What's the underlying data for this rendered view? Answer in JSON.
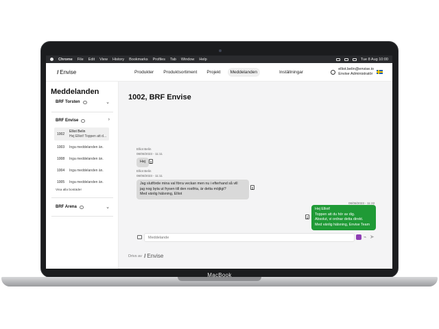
{
  "device": {
    "brand": "MacBook"
  },
  "menubar": {
    "app": "Chrome",
    "items": [
      "File",
      "Edit",
      "View",
      "History",
      "Bookmarks",
      "Profiles",
      "Tab",
      "Window",
      "Help"
    ],
    "clock": "Tue 8 Aug  10:00"
  },
  "header": {
    "logo_text": "Envise",
    "nav": [
      "Produkter",
      "Produktsortiment",
      "Projekt",
      "Meddelanden",
      "Inställningar"
    ],
    "active_nav": "Meddelanden",
    "user_email": "elliot.belin@envise.io",
    "user_role": "Envise Administratör"
  },
  "sidebar": {
    "title": "Meddelanden",
    "groups": [
      {
        "name": "BRF Torsten",
        "expanded": false
      },
      {
        "name": "BRF Envise",
        "expanded": true
      },
      {
        "name": "BRF Arena",
        "expanded": false
      }
    ],
    "threads": [
      {
        "id": "1002",
        "sender": "Elliot Belin",
        "preview": "Hej Elliot! Toppen att d...",
        "selected": true
      },
      {
        "id": "1003",
        "preview": "Inga meddelanden än."
      },
      {
        "id": "1008",
        "preview": "Inga meddelanden än."
      },
      {
        "id": "1004",
        "preview": "Inga meddelanden än."
      },
      {
        "id": "1005",
        "preview": "Inga meddelanden än."
      }
    ],
    "show_all": "Visa alla bostäder"
  },
  "conversation": {
    "title": "1002, BRF Envise",
    "messages": [
      {
        "direction": "in",
        "sender": "Elliot Belin",
        "timestamp": "08/08/2023 - 11:11",
        "text": "Hej"
      },
      {
        "direction": "in",
        "sender": "Elliot Belin",
        "timestamp": "08/08/2023 - 11:11",
        "lines": [
          "Jag slutförde mina val förra veckan men nu i efterhand så vill",
          "jag nog byta ut frysen till den rostfria, är detta möjligt?",
          "Med vänlig hälsning, Elliot"
        ]
      },
      {
        "direction": "out",
        "timestamp": "08/08/2023 - 11:22",
        "lines": [
          "Hej Elliot!",
          "Toppen att du hör av dig.",
          "Absolut, vi ordnar detta direkt.",
          "Med vänlig hälsning, Envise Team"
        ]
      }
    ]
  },
  "composer": {
    "placeholder": "Meddelande"
  },
  "footer": {
    "powered_by": "Drivs av",
    "brand": "Envise"
  },
  "colors": {
    "outgoing_bubble": "#1f9a36",
    "incoming_bubble": "#d9d9d9",
    "accent_button": "#8f3fb5"
  }
}
